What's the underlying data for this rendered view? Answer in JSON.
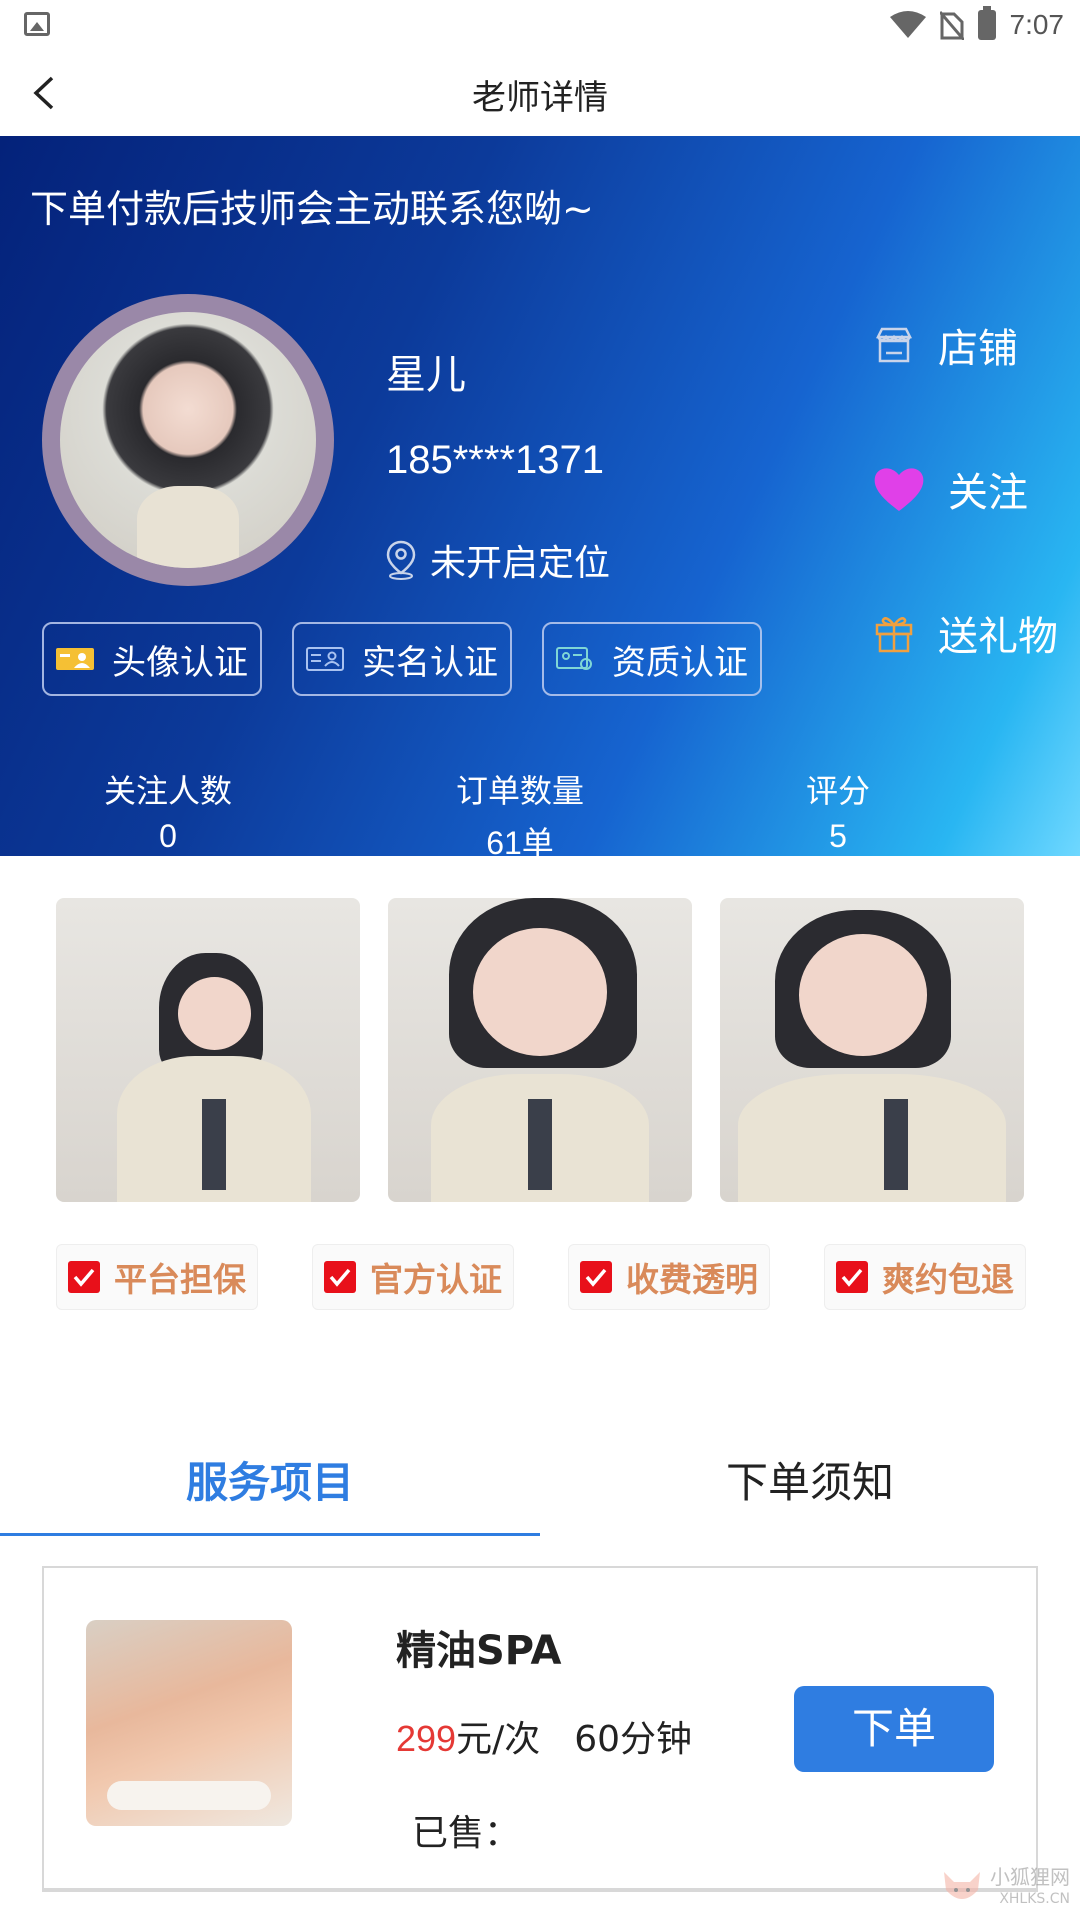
{
  "status_bar": {
    "time": "7:07"
  },
  "header": {
    "title": "老师详情"
  },
  "hero": {
    "notice": "下单付款后技师会主动联系您呦~",
    "name": "星儿",
    "phone": "185****1371",
    "location": "未开启定位",
    "actions": [
      {
        "label": "店铺",
        "icon": "shop-icon",
        "color": "#ffffff"
      },
      {
        "label": "关注",
        "icon": "heart-icon",
        "color": "#e040e8"
      },
      {
        "label": "送礼物",
        "icon": "gift-icon",
        "color": "#f0a040"
      }
    ],
    "badges": [
      {
        "label": "头像认证",
        "icon": "avatar-verify-icon"
      },
      {
        "label": "实名认证",
        "icon": "id-card-icon"
      },
      {
        "label": "资质认证",
        "icon": "certificate-icon"
      }
    ],
    "stats": [
      {
        "label": "关注人数",
        "value": "0"
      },
      {
        "label": "订单数量",
        "value": "61单"
      },
      {
        "label": "评分",
        "value": "5"
      }
    ]
  },
  "guarantees": [
    {
      "label": "平台担保"
    },
    {
      "label": "官方认证"
    },
    {
      "label": "收费透明"
    },
    {
      "label": "爽约包退"
    }
  ],
  "tabs": [
    {
      "label": "服务项目",
      "active": true
    },
    {
      "label": "下单须知",
      "active": false
    }
  ],
  "services": [
    {
      "name": "精油SPA",
      "price": "299",
      "unit": "元/次",
      "duration": "60分钟",
      "sold": "已售：",
      "button": "下单"
    }
  ],
  "watermark": {
    "text": "小狐狸网",
    "sub": "XHLKS.CN"
  },
  "colors": {
    "accent": "#2f7de1",
    "price": "#e53935",
    "guarantee_text": "#d98a5a"
  }
}
